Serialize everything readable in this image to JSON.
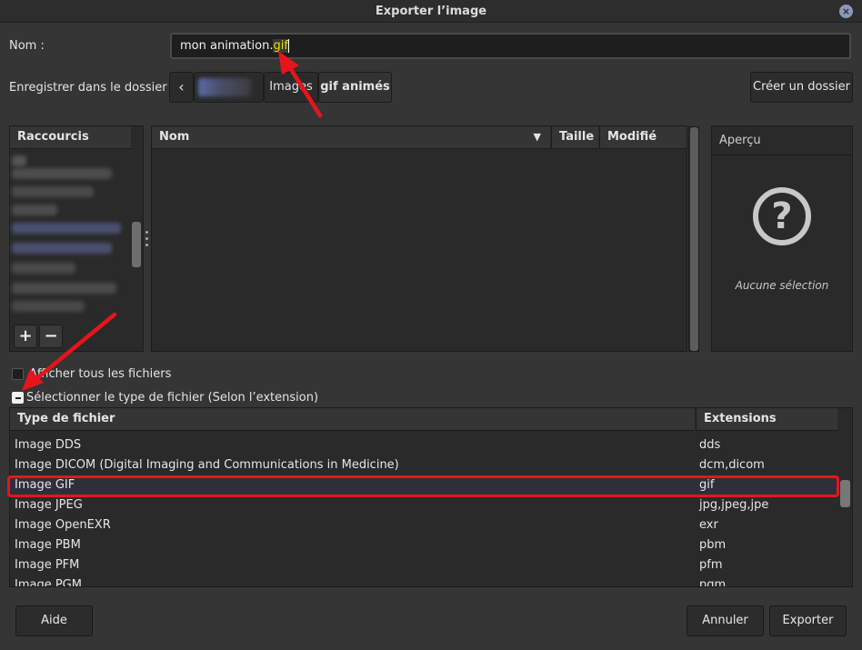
{
  "window": {
    "title": "Exporter l’image"
  },
  "name_row": {
    "label": "Nom :",
    "value_base": "mon animation.",
    "value_selected": "gif"
  },
  "folder_row": {
    "label": "Enregistrer dans le dossier :",
    "path": [
      "Images",
      "gif animés"
    ],
    "create_folder": "Créer un dossier"
  },
  "places": {
    "header": "Raccourcis"
  },
  "files": {
    "col_name": "Nom",
    "col_size": "Taille",
    "col_modified": "Modifié"
  },
  "preview": {
    "header": "Aperçu",
    "empty": "Aucune sélection"
  },
  "options": {
    "show_all": "Afficher tous les fichiers",
    "select_type": "Sélectionner le type de fichier (Selon l’extension)"
  },
  "filetypes": {
    "col_type": "Type de fichier",
    "col_ext": "Extensions",
    "rows": [
      {
        "type": "Image DDS",
        "ext": "dds"
      },
      {
        "type": "Image DICOM (Digital Imaging and Communications in Medicine)",
        "ext": "dcm,dicom"
      },
      {
        "type": "Image GIF",
        "ext": "gif"
      },
      {
        "type": "Image JPEG",
        "ext": "jpg,jpeg,jpe"
      },
      {
        "type": "Image OpenEXR",
        "ext": "exr"
      },
      {
        "type": "Image PBM",
        "ext": "pbm"
      },
      {
        "type": "Image PFM",
        "ext": "pfm"
      },
      {
        "type": "Image PGM",
        "ext": "pgm"
      }
    ]
  },
  "footer": {
    "help": "Aide",
    "cancel": "Annuler",
    "export": "Exporter"
  },
  "colors": {
    "accent_red": "#e8141b",
    "selection_highlight": "#e8e000"
  }
}
